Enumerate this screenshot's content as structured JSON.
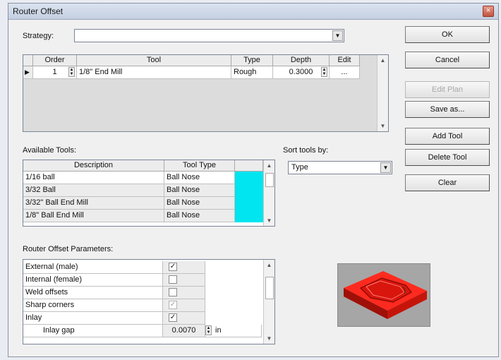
{
  "window": {
    "title": "Router Offset",
    "close_glyph": "×"
  },
  "strategy": {
    "label": "Strategy:",
    "value": ""
  },
  "toolpath_table": {
    "headers": [
      "Order",
      "Tool",
      "Type",
      "Depth",
      "Edit"
    ],
    "rows": [
      {
        "indicator": "▶",
        "order": "1",
        "tool": "1/8\" End Mill",
        "type": "Rough",
        "depth": "0.3000",
        "edit": "..."
      }
    ]
  },
  "buttons": {
    "ok": "OK",
    "cancel": "Cancel",
    "edit_plan": "Edit Plan",
    "save_as": "Save as...",
    "add_tool": "Add Tool",
    "delete_tool": "Delete Tool",
    "clear": "Clear"
  },
  "available_tools": {
    "label": "Available Tools:",
    "headers": [
      "Description",
      "Tool Type"
    ],
    "rows": [
      {
        "description": "1/16 ball",
        "tool_type": "Ball Nose"
      },
      {
        "description": "3/32 Ball",
        "tool_type": "Ball Nose"
      },
      {
        "description": "3/32\" Ball End Mill",
        "tool_type": "Ball Nose"
      },
      {
        "description": "1/8\" Ball End Mill",
        "tool_type": "Ball Nose"
      }
    ],
    "swatch_color": "#00e5ef"
  },
  "sort": {
    "label": "Sort tools by:",
    "value": "Type"
  },
  "parameters": {
    "label": "Router Offset Parameters:",
    "rows": [
      {
        "name": "External (male)",
        "checked": true,
        "enabled": true
      },
      {
        "name": "Internal (female)",
        "checked": false,
        "enabled": true
      },
      {
        "name": "Weld offsets",
        "checked": false,
        "enabled": true
      },
      {
        "name": "Sharp corners",
        "checked": true,
        "enabled": false
      },
      {
        "name": "Inlay",
        "checked": true,
        "enabled": true
      }
    ],
    "inlay_gap": {
      "name": "Inlay gap",
      "value": "0.0070",
      "unit": "in"
    }
  },
  "preview": {
    "accent": "#e8201a"
  }
}
